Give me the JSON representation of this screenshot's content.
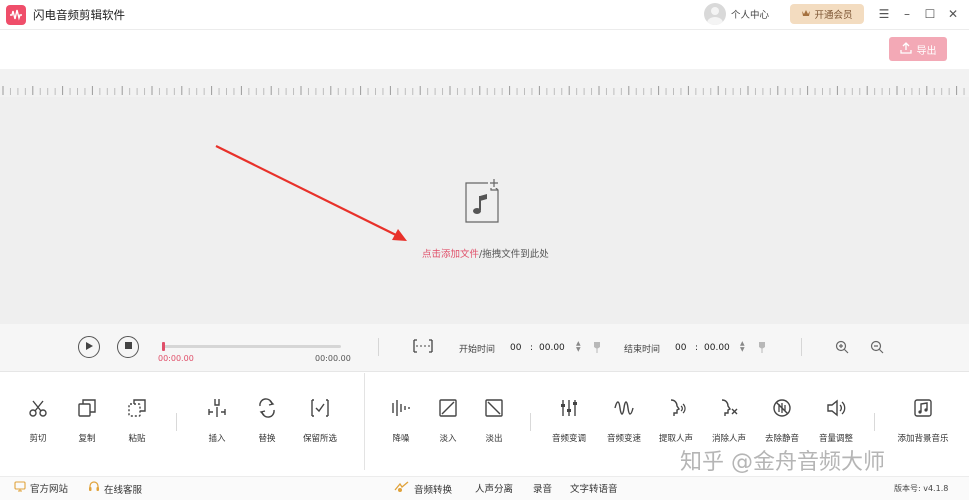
{
  "app": {
    "title": "闪电音频剪辑软件",
    "accent": "#e0506a"
  },
  "header": {
    "user_label": "个人中心",
    "vip_label": "开通会员",
    "export_label": "导出"
  },
  "canvas": {
    "drop_link": "点击添加文件",
    "drop_rest": "/拖拽文件到此处"
  },
  "player": {
    "time_current": "00:00.00",
    "time_total": "00:00.00",
    "start_label": "开始时间",
    "start_min": "00",
    "start_sec": "00.00",
    "end_label": "结束时间",
    "end_min": "00",
    "end_sec": "00.00",
    "colon": ":"
  },
  "tools": [
    {
      "label": "剪切",
      "icon": "scissors-icon"
    },
    {
      "label": "复制",
      "icon": "copy-icon"
    },
    {
      "label": "粘贴",
      "icon": "paste-icon"
    },
    {
      "label": "插入",
      "icon": "insert-icon"
    },
    {
      "label": "替换",
      "icon": "replace-icon"
    },
    {
      "label": "保留所选",
      "icon": "keep-selection-icon"
    },
    {
      "label": "降噪",
      "icon": "denoise-icon"
    },
    {
      "label": "淡入",
      "icon": "fade-in-icon"
    },
    {
      "label": "淡出",
      "icon": "fade-out-icon"
    },
    {
      "label": "音频变调",
      "icon": "pitch-icon"
    },
    {
      "label": "音频变速",
      "icon": "speed-icon"
    },
    {
      "label": "提取人声",
      "icon": "extract-voice-icon"
    },
    {
      "label": "消除人声",
      "icon": "remove-voice-icon"
    },
    {
      "label": "去除静音",
      "icon": "remove-silence-icon"
    },
    {
      "label": "音量调整",
      "icon": "volume-icon"
    },
    {
      "label": "添加背景音乐",
      "icon": "bg-music-icon"
    }
  ],
  "bottom": {
    "website": "官方网站",
    "service": "在线客服",
    "convert": "音频转换",
    "separate": "人声分离",
    "record": "录音",
    "tts": "文字转语音",
    "version": "版本号: v4.1.8"
  },
  "watermark": "知乎 @金舟音频大师"
}
